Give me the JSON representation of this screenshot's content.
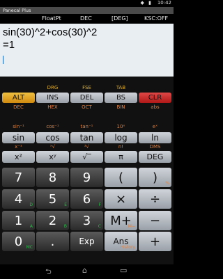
{
  "status": {
    "time": "10:42",
    "icons": "◆ ▮"
  },
  "app_title": "Panecal Plus",
  "mode": {
    "float": "FloatPt",
    "base": "DEC",
    "angle": "[DEG]",
    "ksc": "KSC:OFF"
  },
  "display": {
    "expression": "sin(30)^2+cos(30)^2",
    "result": "=1"
  },
  "rows": {
    "r1_top": [
      "DRG",
      "FSE",
      "TAB"
    ],
    "r1": [
      "ALT",
      "INS",
      "DEL",
      "BS",
      "CLR"
    ],
    "r1_bottom": [
      "DEC",
      "HEX",
      "OCT",
      "BIN",
      "abs"
    ],
    "r2_top": [
      "sin⁻¹",
      "cos⁻¹",
      "tan⁻¹",
      "10ˣ",
      "eˣ"
    ],
    "r2": [
      "sin",
      "cos",
      "tan",
      "log",
      "ln"
    ],
    "r3_top": [
      "x⁻¹",
      "ˣ√",
      "³√",
      "n!",
      "DMS"
    ],
    "r3": [
      "x²",
      "xʸ",
      "√‾",
      "π",
      "DEG"
    ],
    "num": [
      [
        "7",
        "8",
        "9",
        "(",
        ")"
      ],
      [
        "4",
        "5",
        "6",
        "×",
        "÷"
      ],
      [
        "1",
        "2",
        "3",
        "M+",
        "−"
      ],
      [
        "0",
        ".",
        "Exp",
        "Ans",
        "+"
      ]
    ],
    "num_sub": [
      [
        "",
        "",
        "",
        "",
        "%"
      ],
      [
        "D",
        "E",
        "F",
        "",
        ""
      ],
      [
        "A",
        "B",
        "C",
        "M−",
        ""
      ],
      [
        "MC",
        "",
        "",
        "History",
        ""
      ]
    ],
    "history_label": "History"
  },
  "nav": {
    "back": "⮌",
    "home": "⌂",
    "recent": "▭"
  }
}
